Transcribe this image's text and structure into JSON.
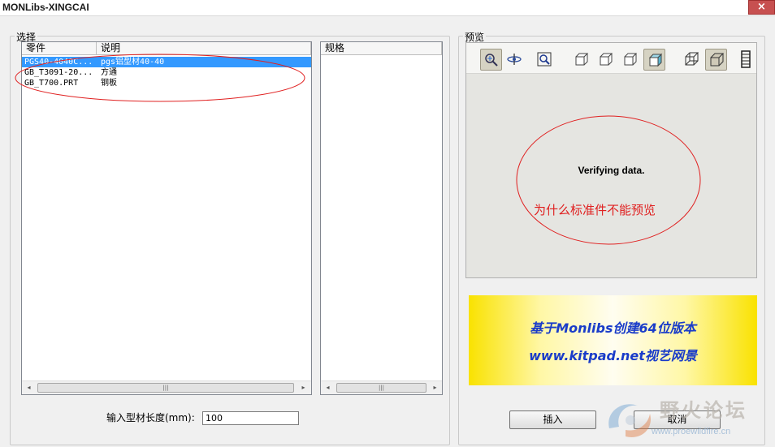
{
  "window": {
    "title": "MONLibs-XINGCAI",
    "close_glyph": "×"
  },
  "select_group": {
    "label": "选择"
  },
  "parts_table": {
    "columns": [
      "零件",
      "说明"
    ],
    "rows": [
      {
        "part": "PGS40-4040C...",
        "desc": "pgs铝型材40-40",
        "selected": true
      },
      {
        "part": "GB_T3091-20...",
        "desc": "方通",
        "selected": false
      },
      {
        "part": "GB_T700.PRT",
        "desc": "钢板",
        "selected": false
      }
    ]
  },
  "spec_table": {
    "columns": [
      "规格"
    ]
  },
  "scroll": {
    "left": "◂",
    "right": "▸",
    "thumb": "|||"
  },
  "length_input": {
    "label": "输入型材长度(mm):",
    "value": "100"
  },
  "preview_group": {
    "label": "预览"
  },
  "toolbar": {
    "buttons": [
      "select-view-icon",
      "spin-icon",
      "zoom-window-icon",
      "view-front-icon",
      "view-top-icon",
      "view-right-icon",
      "view-iso-shaded-icon",
      "wireframe-icon",
      "shaded-icon",
      "film-icon"
    ]
  },
  "preview": {
    "status": "Verifying data.",
    "note": "为什么标准件不能预览"
  },
  "banner": {
    "line1": "基于Monlibs创建64位版本",
    "line2": "www.kitpad.net视艺网景"
  },
  "buttons": {
    "insert": "插入",
    "cancel": "取消"
  },
  "watermark": {
    "title": "野火论坛",
    "url": "www.proewildfire.cn"
  },
  "colors": {
    "selection": "#3399ff",
    "annotation": "#e02020",
    "banner_text": "#1a3cc9",
    "banner_yellow": "#f9e200"
  }
}
